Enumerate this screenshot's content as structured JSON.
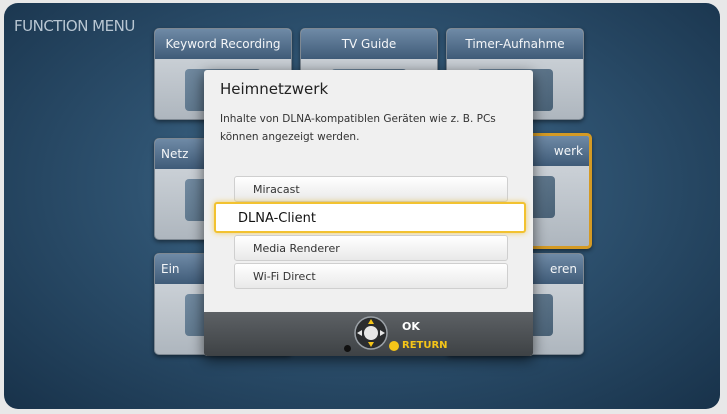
{
  "menu": {
    "title": "FUNCTION MENU"
  },
  "tiles": [
    {
      "label": "Keyword Recording",
      "icon": "keyword-recording-icon"
    },
    {
      "label": "TV Guide",
      "icon": "tv-guide-icon"
    },
    {
      "label": "Timer-Aufnahme",
      "icon": "timer-clock-icon"
    },
    {
      "label": "Netz",
      "icon": "network-icon"
    },
    {
      "label": "werk",
      "icon": "home-network-icon"
    },
    {
      "label": "Ein",
      "icon": "settings-icon"
    },
    {
      "label": "eren",
      "icon": "media-icon"
    }
  ],
  "dialog": {
    "title": "Heimnetzwerk",
    "description": "Inhalte von DLNA-kompatiblen Geräten wie z. B. PCs können angezeigt werden.",
    "options": [
      "Miracast",
      "DLNA-Client",
      "Media Renderer",
      "Wi-Fi Direct"
    ],
    "selected_option": "DLNA-Client"
  },
  "footer": {
    "ok_label": "OK",
    "return_label": "RETURN",
    "return_color": "#f5c518"
  }
}
